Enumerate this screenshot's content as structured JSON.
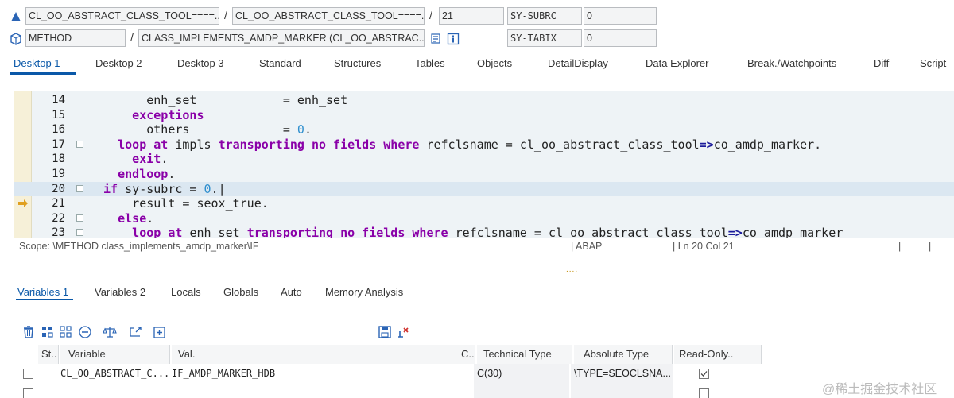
{
  "header": {
    "row1": {
      "class_field": "CL_OO_ABSTRACT_CLASS_TOOL====...",
      "class_field2": "CL_OO_ABSTRACT_CLASS_TOOL====...",
      "line_field": "21",
      "sysvar_name": "SY-SUBRC",
      "sysvar_value": "0",
      "sep1": "/",
      "sep2": "/"
    },
    "row2": {
      "type_field": "METHOD",
      "method_field": "CLASS_IMPLEMENTS_AMDP_MARKER (CL_OO_ABSTRAC...",
      "sysvar_name": "SY-TABIX",
      "sysvar_value": "0",
      "sep1": "/"
    }
  },
  "tabs": [
    "Desktop 1",
    "Desktop 2",
    "Desktop 3",
    "Standard",
    "Structures",
    "Tables",
    "Objects",
    "DetailDisplay",
    "Data Explorer",
    "Break./Watchpoints",
    "Diff",
    "Script"
  ],
  "editor": {
    "lines": [
      {
        "n": "14",
        "text_parts": [
          [
            "plain",
            "        enh_set            = enh_set"
          ]
        ]
      },
      {
        "n": "15",
        "text_parts": [
          [
            "kw",
            "      exceptions"
          ]
        ]
      },
      {
        "n": "16",
        "text_parts": [
          [
            "plain",
            "        others             = "
          ],
          [
            "num",
            "0"
          ],
          [
            "dot",
            "."
          ]
        ]
      },
      {
        "n": "17",
        "text_parts": [
          [
            "kw",
            "    loop at "
          ],
          [
            "plain",
            "impls "
          ],
          [
            "kw",
            "transporting no fields where "
          ],
          [
            "plain",
            "refclsname = cl_oo_abstract_class_tool"
          ],
          [
            "op",
            "=>"
          ],
          [
            "plain",
            "co_amdp_marker"
          ],
          [
            "dot",
            "."
          ]
        ]
      },
      {
        "n": "18",
        "text_parts": [
          [
            "kw",
            "      exit"
          ],
          [
            "dot",
            "."
          ]
        ]
      },
      {
        "n": "19",
        "text_parts": [
          [
            "kw",
            "    endloop"
          ],
          [
            "dot",
            "."
          ]
        ]
      },
      {
        "n": "20",
        "text_parts": [
          [
            "kw",
            "  if "
          ],
          [
            "plain",
            "sy-subrc = "
          ],
          [
            "num",
            "0"
          ],
          [
            "dot",
            "."
          ],
          [
            "plain",
            "|"
          ]
        ]
      },
      {
        "n": "21",
        "text_parts": [
          [
            "plain",
            "      result = seox_true"
          ],
          [
            "dot",
            "."
          ]
        ]
      },
      {
        "n": "22",
        "text_parts": [
          [
            "kw",
            "    else"
          ],
          [
            "dot",
            "."
          ]
        ]
      },
      {
        "n": "23",
        "text_parts": [
          [
            "kw",
            "      loop at "
          ],
          [
            "plain",
            "enh_set "
          ],
          [
            "kw",
            "transporting no fields where "
          ],
          [
            "plain",
            "refclsname = cl_oo_abstract_class_tool"
          ],
          [
            "op",
            "=>"
          ],
          [
            "plain",
            "co_amdp_marker"
          ]
        ]
      }
    ]
  },
  "status": {
    "scope": "Scope: \\METHOD class_implements_amdp_marker\\IF",
    "lang": "| ABAP",
    "position": "| Ln  20 Col  21",
    "pipe1": "|",
    "pipe2": "|"
  },
  "splitter_dots": "....",
  "lower_tabs": [
    "Variables 1",
    "Variables 2",
    "Locals",
    "Globals",
    "Auto",
    "Memory Analysis"
  ],
  "table": {
    "headers": [
      "St..",
      "Variable",
      "Val.",
      "C..",
      "Technical Type",
      "Absolute Type",
      "Read-Only.."
    ],
    "rows": [
      {
        "variable": "CL_OO_ABSTRACT_C...",
        "value": "IF_AMDP_MARKER_HDB",
        "tech_type": "C(30)",
        "abs_type": "\\TYPE=SEOCLSNA...",
        "read_only": true
      },
      {
        "variable": "",
        "value": "",
        "tech_type": "",
        "abs_type": "",
        "read_only": false
      }
    ]
  },
  "watermark": "@稀土掘金技术社区",
  "colors": {
    "keyword": "#8a00a8",
    "number": "#2f8fce",
    "accent": "#0a58a8",
    "current_line": "#dbe7f1"
  }
}
